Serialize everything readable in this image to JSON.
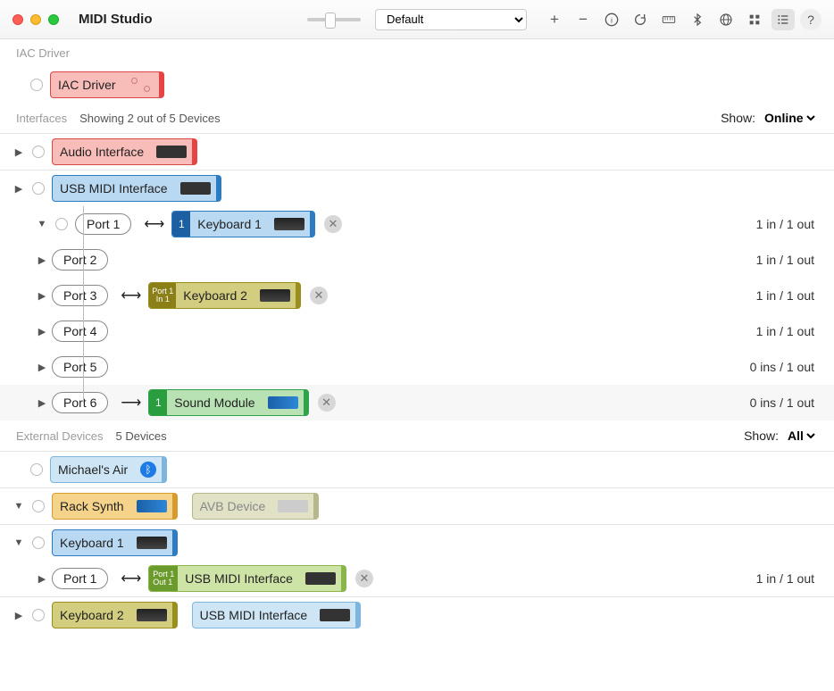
{
  "window": {
    "title": "MIDI Studio",
    "config_selected": "Default"
  },
  "toolbar_icons": [
    "plus",
    "minus",
    "info",
    "refresh",
    "keyboard",
    "bluetooth",
    "globe",
    "grid",
    "list",
    "help"
  ],
  "sections": {
    "iac": {
      "label": "IAC Driver",
      "device": "IAC Driver"
    },
    "interfaces": {
      "label": "Interfaces",
      "subtitle": "Showing 2 out of 5 Devices",
      "show_label": "Show:",
      "show_value": "Online",
      "items": [
        {
          "name": "Audio Interface",
          "color": "red"
        },
        {
          "name": "USB MIDI Interface",
          "color": "blue",
          "ports": [
            {
              "name": "Port 1",
              "arrow": "bi",
              "attached": {
                "badge": "1",
                "name": "Keyboard 1",
                "color": "blue"
              },
              "io": "1 in / 1 out",
              "remove": true
            },
            {
              "name": "Port 2",
              "io": "1 in / 1 out"
            },
            {
              "name": "Port 3",
              "arrow": "bi",
              "attached": {
                "badge": "Port 1\nIn 1",
                "name": "Keyboard 2",
                "color": "olive"
              },
              "io": "1 in / 1 out",
              "remove": true
            },
            {
              "name": "Port 4",
              "io": "1 in / 1 out"
            },
            {
              "name": "Port 5",
              "io": "0 ins / 1 out"
            },
            {
              "name": "Port 6",
              "arrow": "uni",
              "attached": {
                "badge": "1",
                "name": "Sound Module",
                "color": "green"
              },
              "io": "0 ins / 1 out",
              "remove": true
            }
          ]
        }
      ]
    },
    "external": {
      "label": "External Devices",
      "subtitle": "5 Devices",
      "show_label": "Show:",
      "show_value": "All",
      "items": [
        {
          "name": "Michael's Air",
          "color": "lblue",
          "bluetooth": true
        },
        {
          "name": "Rack Synth",
          "color": "orange",
          "sibling": {
            "name": "AVB Device",
            "color": "sage"
          }
        },
        {
          "name": "Keyboard 1",
          "color": "blue",
          "ports": [
            {
              "name": "Port 1",
              "arrow": "bi",
              "attached": {
                "badge": "Port 1\nOut 1",
                "name": "USB MIDI Interface",
                "color": "arm"
              },
              "io": "1 in / 1 out",
              "remove": true
            }
          ]
        },
        {
          "name": "Keyboard 2",
          "color": "olive",
          "sibling": {
            "name": "USB MIDI Interface",
            "color": "lblue"
          }
        }
      ]
    }
  }
}
